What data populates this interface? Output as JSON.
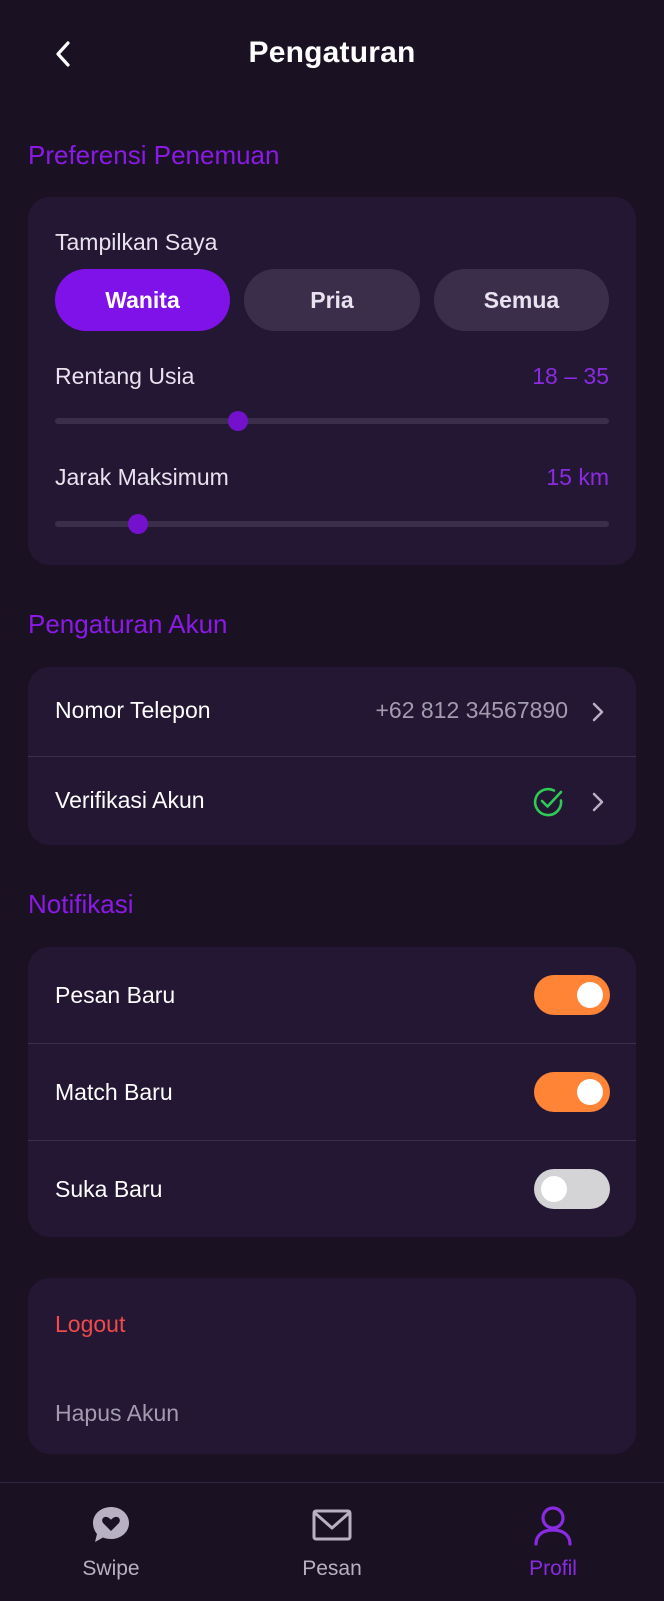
{
  "header": {
    "title": "Pengaturan",
    "back_icon": "chevron-left-icon"
  },
  "discovery": {
    "section_title": "Preferensi Penemuan",
    "show_me_label": "Tampilkan Saya",
    "options": [
      "Wanita",
      "Pria",
      "Semua"
    ],
    "selected": "Wanita",
    "age_label": "Rentang Usia",
    "age_value": "18 – 35",
    "age_slider_fraction": 0.33,
    "distance_label": "Jarak Maksimum",
    "distance_value": "15 km",
    "distance_slider_fraction": 0.15
  },
  "account": {
    "section_title": "Pengaturan Akun",
    "phone_label": "Nomor Telepon",
    "phone_value": "+62 812 34567890",
    "verify_label": "Verifikasi Akun",
    "verify_icon": "check-circle-icon"
  },
  "notifications": {
    "section_title": "Notifikasi",
    "items": [
      {
        "label": "Pesan Baru",
        "on": true
      },
      {
        "label": "Match Baru",
        "on": true
      },
      {
        "label": "Suka Baru",
        "on": false
      }
    ]
  },
  "danger": {
    "logout_label": "Logout",
    "delete_label": "Hapus Akun"
  },
  "nav": {
    "items": [
      {
        "label": "Swipe",
        "icon": "chat-heart-icon",
        "active": false
      },
      {
        "label": "Pesan",
        "icon": "envelope-icon",
        "active": false
      },
      {
        "label": "Profil",
        "icon": "user-icon",
        "active": true
      }
    ]
  },
  "colors": {
    "background": "#1a1222",
    "card": "#231734",
    "accent_purple": "#7f12e8",
    "toggle_on": "#ff8436",
    "danger_red": "#f04a4a",
    "success_green": "#2ecc55"
  }
}
